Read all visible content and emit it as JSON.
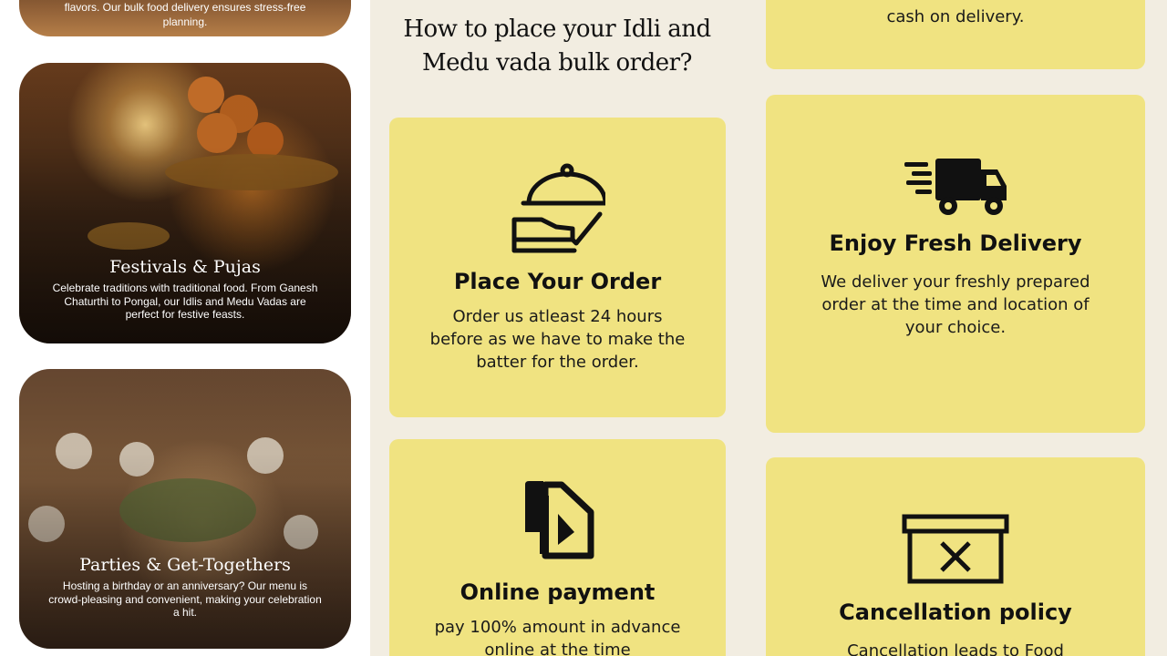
{
  "events": [
    {
      "desc": "flavors. Our bulk food delivery ensures stress-free planning."
    },
    {
      "title": "Festivals & Pujas",
      "desc": "Celebrate traditions with traditional food. From Ganesh Chaturthi to Pongal, our Idlis and Medu Vadas are perfect for festive feasts."
    },
    {
      "title": "Parties & Get-Togethers",
      "desc": "Hosting a birthday or an anniversary? Our menu is crowd-pleasing and convenient, making your celebration a hit."
    }
  ],
  "heading": "How to place your Idli and Medu vada bulk order?",
  "steps": {
    "prev_desc": "cash on delivery.",
    "order": {
      "title": "Place Your Order",
      "desc": "Order us atleast 24 hours before as we have to make the batter for the order.",
      "icon": "food-tray-icon"
    },
    "delivery": {
      "title": "Enjoy Fresh Delivery",
      "desc": "We deliver your freshly prepared order at the time and location of your choice.",
      "icon": "delivery-truck-icon"
    },
    "payment": {
      "title": "Online payment",
      "desc": "pay 100% amount in advance online at the time",
      "icon": "payment-document-icon"
    },
    "cancel": {
      "title": "Cancellation policy",
      "desc": "Cancellation leads to Food",
      "icon": "cancel-box-icon"
    }
  },
  "colors": {
    "card": "#f0e381",
    "background": "#f2ede1",
    "text": "#151515"
  }
}
